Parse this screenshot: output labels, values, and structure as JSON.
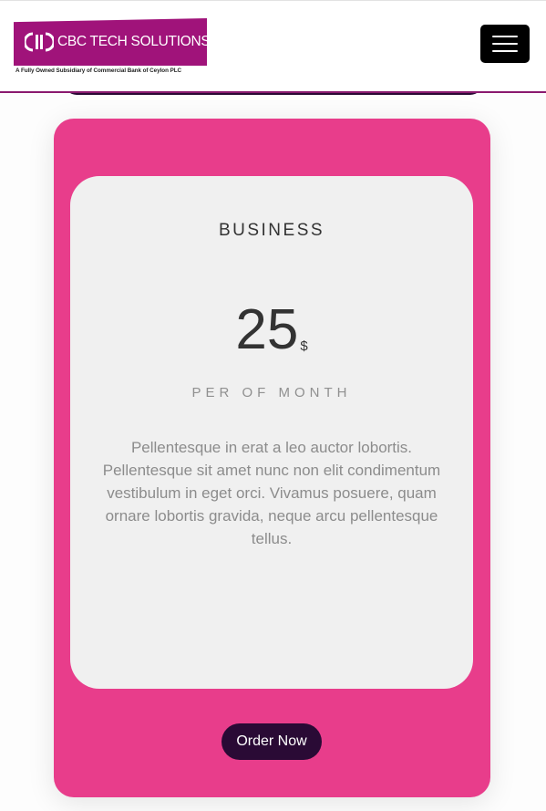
{
  "header": {
    "logo": {
      "name": "CBC TECH SOLUTIONS",
      "tagline": "A Fully Owned Subsidiary of Commercial Bank of Ceylon PLC",
      "brand_color": "#a0137a"
    },
    "menu_icon": "hamburger-menu-icon"
  },
  "pricing": {
    "plan_name": "BUSINESS",
    "price": "25",
    "currency": "$",
    "period": "PER OF MONTH",
    "description": "Pellentesque in erat a leo auctor lobortis. Pellentesque sit amet nunc non elit condimentum vestibulum in eget orci. Vivamus posuere, quam ornare lobortis gravida, neque arcu pellentesque tellus.",
    "order_label": "Order Now"
  },
  "colors": {
    "card_background": "#e83d8b",
    "inner_background": "#f0f0f0",
    "button_background": "#2a0a35",
    "header_border": "#8a1a6f"
  }
}
